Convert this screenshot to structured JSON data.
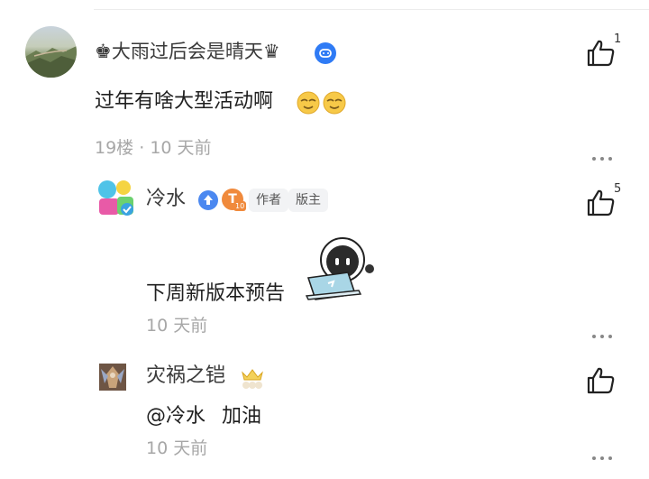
{
  "comments": [
    {
      "username": "♚大雨过后会是晴天♛",
      "text": "过年有啥大型活动啊",
      "floor": "19楼",
      "separator": " · ",
      "time": "10 天前",
      "likes": "1",
      "emoji": [
        "smiling-sunglasses-emoji",
        "smiling-sunglasses-emoji"
      ]
    },
    {
      "username": "冷水",
      "level_badge": "T",
      "level_number": "10",
      "tags": [
        "作者",
        "版主"
      ],
      "text": "下周新版本预告",
      "time": "10 天前",
      "likes": "5"
    },
    {
      "username": "灾祸之铠",
      "mention": "@冷水",
      "text": "加油",
      "time": "10 天前"
    }
  ],
  "colors": {
    "accent_blue": "#2f7bf5",
    "level_orange": "#f08a3c",
    "meta_gray": "#a7a7a7"
  }
}
